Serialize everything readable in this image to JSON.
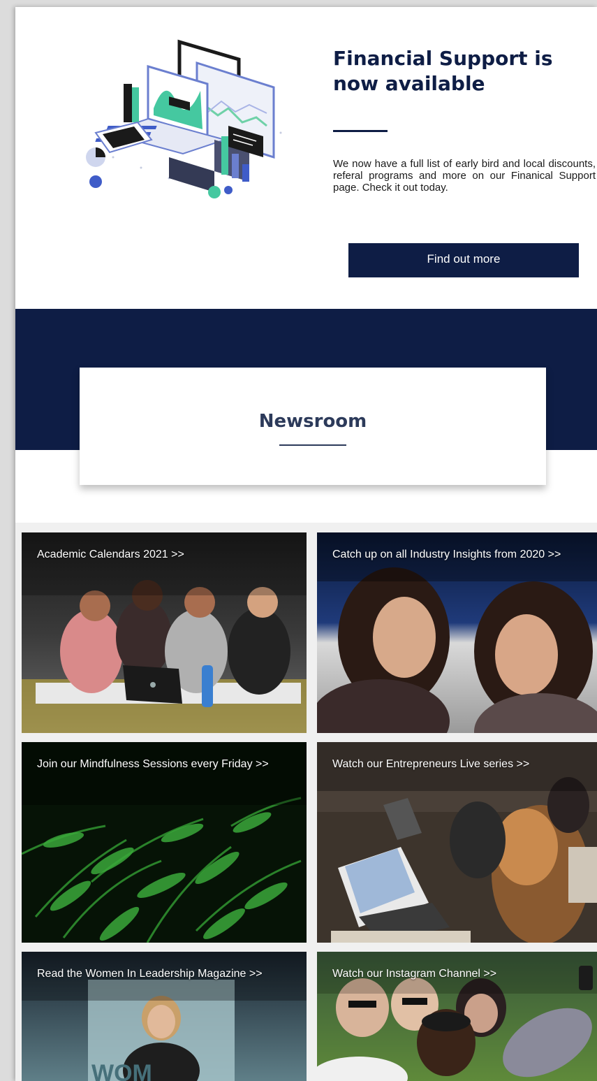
{
  "hero": {
    "title": "Financial Support is now available",
    "body": "We now have a full list of early bird and local discounts, referal programs and more on our Finanical Support page. Check it out today.",
    "button_label": "Find out more"
  },
  "newsroom": {
    "title": "Newsroom"
  },
  "tiles": [
    {
      "label": "Academic Calendars 2021 >>"
    },
    {
      "label": "Catch up on all Industry Insights from 2020  >>"
    },
    {
      "label": "Join our Mindfulness Sessions every Friday  >>"
    },
    {
      "label": "Watch our Entrepreneurs Live series  >>"
    },
    {
      "label": "Read the Women In Leadership Magazine  >>"
    },
    {
      "label": "Watch our Instagram Channel >>"
    }
  ],
  "colors": {
    "navy": "#0e1d45",
    "white": "#ffffff",
    "tile_gap": "#f0f0f0"
  }
}
